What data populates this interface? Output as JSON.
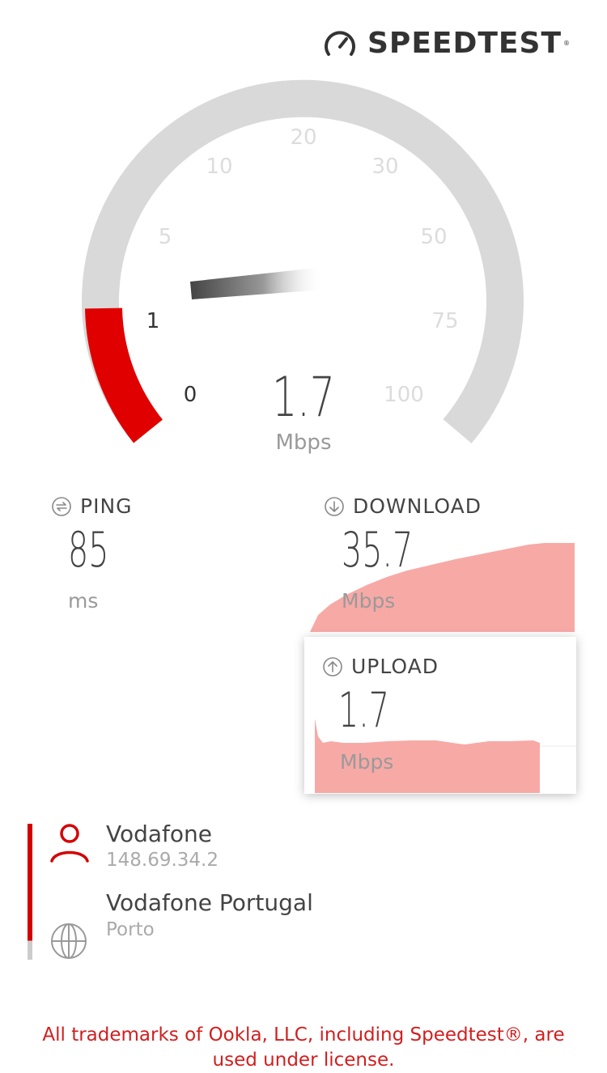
{
  "header": {
    "logo_text": "SPEEDTEST",
    "logo_icon": "speedometer-icon"
  },
  "gauge": {
    "ticks": [
      "0",
      "1",
      "5",
      "10",
      "20",
      "30",
      "50",
      "75",
      "100"
    ],
    "active_tick": "1",
    "value": "1.7",
    "unit": "Mbps"
  },
  "ping": {
    "label": "PING",
    "value": "85",
    "unit": "ms"
  },
  "download": {
    "label": "DOWNLOAD",
    "value": "35.7",
    "unit": "Mbps"
  },
  "upload": {
    "label": "UPLOAD",
    "value": "1.7",
    "unit": "Mbps"
  },
  "server": {
    "provider": "Vodafone",
    "ip": "148.69.34.2",
    "host": "Vodafone Portugal",
    "city": "Porto"
  },
  "footer": {
    "line1": "All trademarks of Ookla, LLC, including Speedtest®, are",
    "line2": "used under license."
  },
  "colors": {
    "accent": "#e00000",
    "chart_fill": "#f7a9a6",
    "track": "#d9d9d9",
    "footer_text": "#d21e1e"
  }
}
